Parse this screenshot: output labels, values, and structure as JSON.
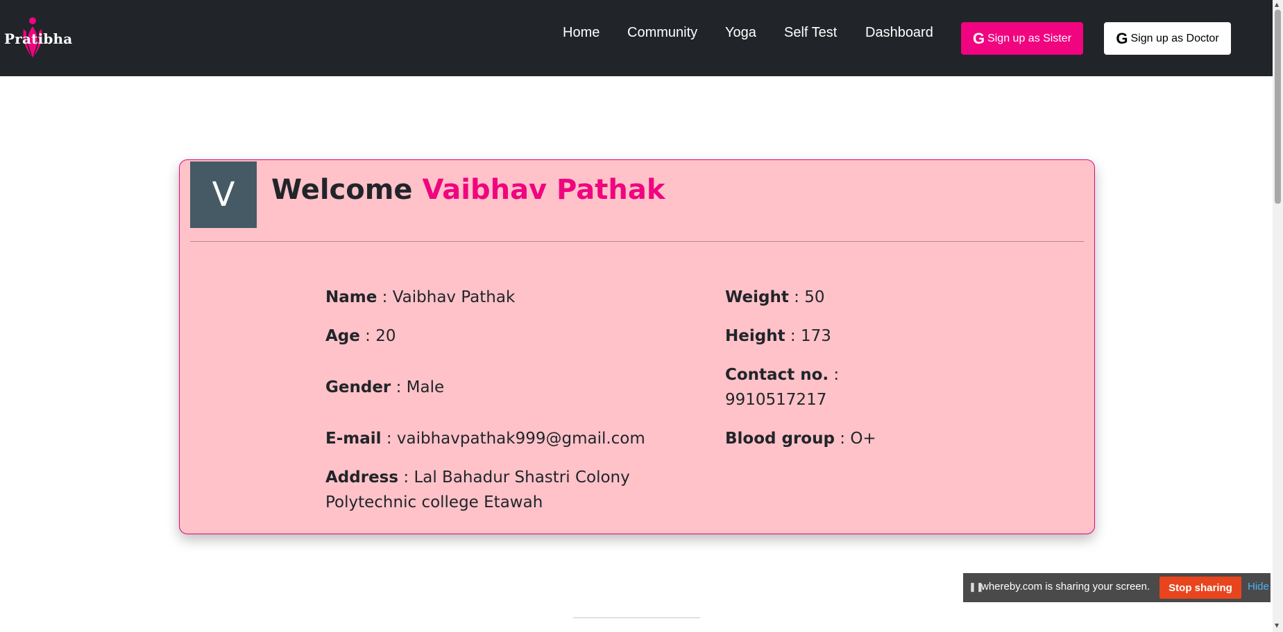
{
  "brand": {
    "name": "Pratibha"
  },
  "nav": {
    "links": [
      "Home",
      "Community",
      "Yoga",
      "Self Test",
      "Dashboard"
    ],
    "signup_sister": "Sign up as Sister",
    "signup_doctor": "Sign up as Doctor",
    "google_glyph": "G"
  },
  "profile": {
    "avatar_letter": "V",
    "welcome_prefix": "Welcome",
    "welcome_name": "Vaibhav Pathak",
    "fields": {
      "name": {
        "label": "Name",
        "value": "Vaibhav Pathak"
      },
      "age": {
        "label": "Age",
        "value": "20"
      },
      "gender": {
        "label": "Gender",
        "value": "Male"
      },
      "email": {
        "label": "E-mail",
        "value": "vaibhavpathak999@gmail.com"
      },
      "address": {
        "label": "Address",
        "value": "Lal Bahadur Shastri Colony Polytechnic college Etawah"
      },
      "weight": {
        "label": "Weight",
        "value": "50"
      },
      "height": {
        "label": "Height",
        "value": "173"
      },
      "contact": {
        "label": "Contact no.",
        "value": "9910517217"
      },
      "blood": {
        "label": "Blood group",
        "value": "O+"
      }
    }
  },
  "share_bar": {
    "pause_icon": "pause-icon",
    "message": "whereby.com is sharing your screen.",
    "stop_label": "Stop sharing",
    "hide_label": "Hide"
  },
  "colors": {
    "navbar": "#212529",
    "accent_pink": "#f0047f",
    "card_bg": "#ffc2c9",
    "avatar_bg": "#455a64",
    "stop_button": "#e8451e",
    "hide_link": "#4ab3f4"
  }
}
